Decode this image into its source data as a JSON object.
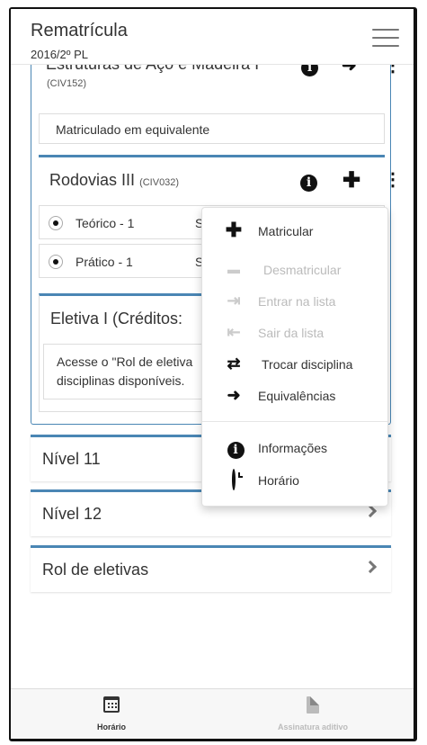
{
  "header": {
    "title": "Rematrícula",
    "subtitle": "2016/2º PL"
  },
  "disciplines": {
    "estruturas": {
      "title": "Estruturas de Aço e Madeira I",
      "code": "(CIV152)",
      "note": "Matriculado em equivalente"
    },
    "rodovias": {
      "title": "Rodovias III",
      "code": "(CIV032)",
      "classes": [
        {
          "label": "Teórico - 1",
          "extra": "S"
        },
        {
          "label": "Prático - 1",
          "extra": "S"
        }
      ]
    },
    "eletiva": {
      "title": "Eletiva I (Créditos:",
      "note_line1": "Acesse o \"Rol de eletiva",
      "note_line2": "disciplinas disponíveis."
    }
  },
  "levels": [
    {
      "label": "Nível 11"
    },
    {
      "label": "Nível 12"
    },
    {
      "label": "Rol de eletivas"
    }
  ],
  "dropdown": {
    "items": [
      {
        "label": "Matricular",
        "icon": "plus-icon",
        "glyph": "✚",
        "enabled": true
      },
      {
        "label": "Desmatricular",
        "icon": "minus-icon",
        "glyph": "▬",
        "enabled": false
      },
      {
        "label": "Entrar na lista",
        "icon": "sign-in-icon",
        "glyph": "⇥",
        "enabled": false
      },
      {
        "label": "Sair da lista",
        "icon": "sign-out-icon",
        "glyph": "⇤",
        "enabled": false
      },
      {
        "label": "Trocar disciplina",
        "icon": "exchange-icon",
        "glyph": "⇄",
        "enabled": true
      },
      {
        "label": "Equivalências",
        "icon": "arrow-right-icon",
        "glyph": "➜",
        "enabled": true
      },
      {
        "label": "Informações",
        "icon": "info-icon",
        "glyph": "i",
        "enabled": true
      },
      {
        "label": "Horário",
        "icon": "clock-icon",
        "glyph": "",
        "enabled": true
      }
    ]
  },
  "tabs": {
    "horario": "Horário",
    "assinatura": "Assinatura aditivo"
  },
  "colors": {
    "accent": "#4a86b4",
    "disabled": "#bbbbbb"
  }
}
